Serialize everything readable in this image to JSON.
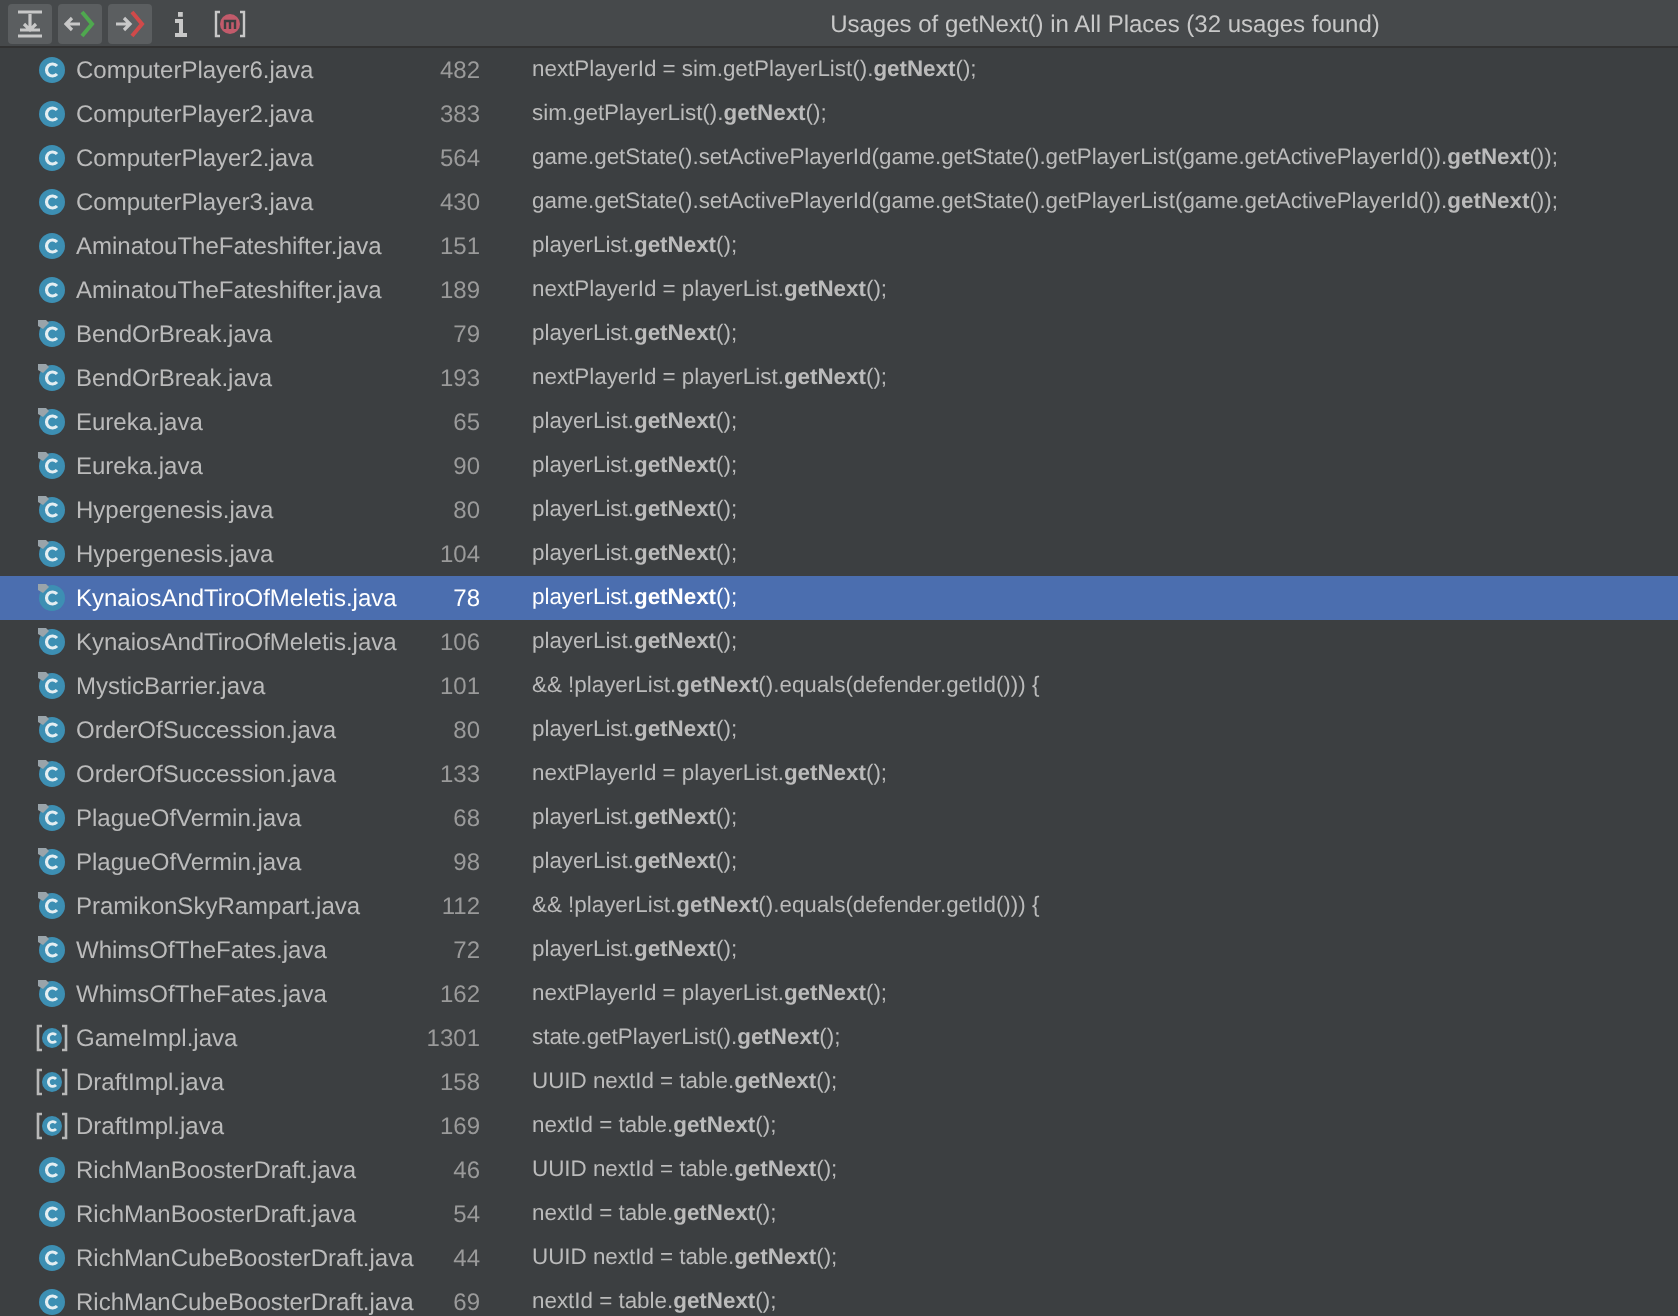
{
  "toolbar": {
    "buttons": [
      {
        "kind": "flatten",
        "pressed": true
      },
      {
        "kind": "import",
        "pressed": true
      },
      {
        "kind": "export",
        "pressed": true
      },
      {
        "kind": "info",
        "pressed": false
      },
      {
        "kind": "method",
        "pressed": false
      }
    ],
    "title": "Usages of getNext() in All Places (32 usages found)"
  },
  "usages": [
    {
      "kind": "class",
      "file": "ComputerPlayer6.java",
      "line": "482",
      "code": "nextPlayerId = sim.getPlayerList().**getNext**();",
      "selected": false
    },
    {
      "kind": "class",
      "file": "ComputerPlayer2.java",
      "line": "383",
      "code": "sim.getPlayerList().**getNext**();",
      "selected": false
    },
    {
      "kind": "class",
      "file": "ComputerPlayer2.java",
      "line": "564",
      "code": "game.getState().setActivePlayerId(game.getState().getPlayerList(game.getActivePlayerId()).**getNext**());",
      "selected": false
    },
    {
      "kind": "class",
      "file": "ComputerPlayer3.java",
      "line": "430",
      "code": "game.getState().setActivePlayerId(game.getState().getPlayerList(game.getActivePlayerId()).**getNext**());",
      "selected": false
    },
    {
      "kind": "class",
      "file": "AminatouTheFateshifter.java",
      "line": "151",
      "code": "playerList.**getNext**();",
      "selected": false
    },
    {
      "kind": "class",
      "file": "AminatouTheFateshifter.java",
      "line": "189",
      "code": "nextPlayerId = playerList.**getNext**();",
      "selected": false
    },
    {
      "kind": "tagged",
      "file": "BendOrBreak.java",
      "line": "79",
      "code": "playerList.**getNext**();",
      "selected": false
    },
    {
      "kind": "tagged",
      "file": "BendOrBreak.java",
      "line": "193",
      "code": "nextPlayerId = playerList.**getNext**();",
      "selected": false
    },
    {
      "kind": "tagged",
      "file": "Eureka.java",
      "line": "65",
      "code": "playerList.**getNext**();",
      "selected": false
    },
    {
      "kind": "tagged",
      "file": "Eureka.java",
      "line": "90",
      "code": "playerList.**getNext**();",
      "selected": false
    },
    {
      "kind": "tagged",
      "file": "Hypergenesis.java",
      "line": "80",
      "code": "playerList.**getNext**();",
      "selected": false
    },
    {
      "kind": "tagged",
      "file": "Hypergenesis.java",
      "line": "104",
      "code": "playerList.**getNext**();",
      "selected": false
    },
    {
      "kind": "tagged",
      "file": "KynaiosAndTiroOfMeletis.java",
      "line": "78",
      "code": "playerList.**getNext**();",
      "selected": true
    },
    {
      "kind": "tagged",
      "file": "KynaiosAndTiroOfMeletis.java",
      "line": "106",
      "code": "playerList.**getNext**();",
      "selected": false
    },
    {
      "kind": "tagged",
      "file": "MysticBarrier.java",
      "line": "101",
      "code": "&& !playerList.**getNext**().equals(defender.getId())) {",
      "selected": false
    },
    {
      "kind": "tagged",
      "file": "OrderOfSuccession.java",
      "line": "80",
      "code": "playerList.**getNext**();",
      "selected": false
    },
    {
      "kind": "tagged",
      "file": "OrderOfSuccession.java",
      "line": "133",
      "code": "nextPlayerId = playerList.**getNext**();",
      "selected": false
    },
    {
      "kind": "tagged",
      "file": "PlagueOfVermin.java",
      "line": "68",
      "code": "playerList.**getNext**();",
      "selected": false
    },
    {
      "kind": "tagged",
      "file": "PlagueOfVermin.java",
      "line": "98",
      "code": "playerList.**getNext**();",
      "selected": false
    },
    {
      "kind": "tagged",
      "file": "PramikonSkyRampart.java",
      "line": "112",
      "code": "&& !playerList.**getNext**().equals(defender.getId())) {",
      "selected": false
    },
    {
      "kind": "tagged",
      "file": "WhimsOfTheFates.java",
      "line": "72",
      "code": "playerList.**getNext**();",
      "selected": false
    },
    {
      "kind": "tagged",
      "file": "WhimsOfTheFates.java",
      "line": "162",
      "code": "nextPlayerId = playerList.**getNext**();",
      "selected": false
    },
    {
      "kind": "bracket",
      "file": "GameImpl.java",
      "line": "1301",
      "code": "state.getPlayerList().**getNext**();",
      "selected": false
    },
    {
      "kind": "bracket",
      "file": "DraftImpl.java",
      "line": "158",
      "code": "UUID nextId = table.**getNext**();",
      "selected": false
    },
    {
      "kind": "bracket",
      "file": "DraftImpl.java",
      "line": "169",
      "code": "nextId = table.**getNext**();",
      "selected": false
    },
    {
      "kind": "class",
      "file": "RichManBoosterDraft.java",
      "line": "46",
      "code": "UUID nextId = table.**getNext**();",
      "selected": false
    },
    {
      "kind": "class",
      "file": "RichManBoosterDraft.java",
      "line": "54",
      "code": "nextId = table.**getNext**();",
      "selected": false
    },
    {
      "kind": "class",
      "file": "RichManCubeBoosterDraft.java",
      "line": "44",
      "code": "UUID nextId = table.**getNext**();",
      "selected": false
    },
    {
      "kind": "class",
      "file": "RichManCubeBoosterDraft.java",
      "line": "69",
      "code": "nextId = table.**getNext**();",
      "selected": false
    }
  ]
}
